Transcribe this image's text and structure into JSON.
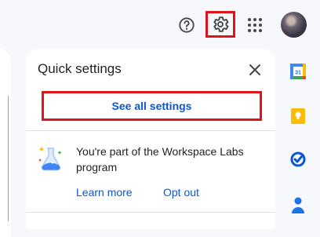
{
  "header": {
    "help_icon": "help-icon",
    "settings_icon": "gear-icon",
    "apps_icon": "apps-grid-icon",
    "avatar": "account-avatar"
  },
  "quick_settings": {
    "title": "Quick settings",
    "see_all_label": "See all settings",
    "labs_message": "You're part of the Workspace Labs program",
    "learn_more_label": "Learn more",
    "opt_out_label": "Opt out"
  },
  "side_rail": {
    "calendar_day": "31",
    "apps": [
      "calendar-icon",
      "keep-icon",
      "tasks-icon",
      "contacts-icon"
    ]
  },
  "colors": {
    "highlight": "#e0121a",
    "link": "#0b57d0",
    "background": "#f6f8fc"
  }
}
